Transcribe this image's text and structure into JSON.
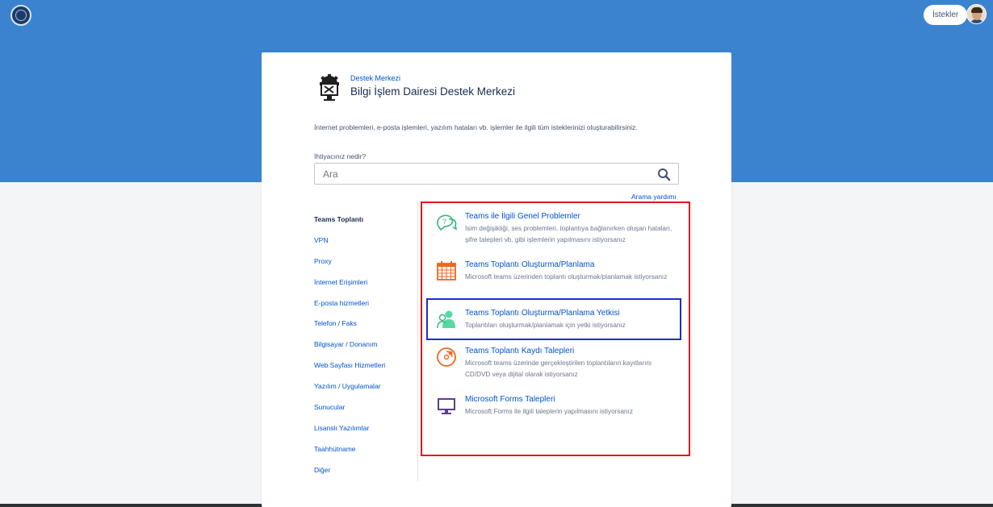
{
  "header": {
    "logo_icon": "university-logo-icon",
    "requests_label": "İstekler",
    "avatar_icon": "user-avatar-icon",
    "accent_color": "#3b83cf"
  },
  "help_center": {
    "icon": "gear-monitor-icon",
    "breadcrumb": "Destek Merkezi",
    "title": "Bilgi İşlem Dairesi Destek Merkezi",
    "intro": "İnternet problemleri, e-posta işlemleri, yazılım hataları vb. işlemler ile ilgili tüm isteklerinizi oluşturabilirsiniz."
  },
  "search": {
    "label": "İhtiyacınız nedir?",
    "placeholder": "Ara",
    "help_link": "Arama yardımı"
  },
  "sidebar": {
    "items": [
      {
        "label": "Teams Toplantı",
        "active": true
      },
      {
        "label": "VPN"
      },
      {
        "label": "Proxy"
      },
      {
        "label": "İnternet Erişimleri"
      },
      {
        "label": "E-posta hizmetleri"
      },
      {
        "label": "Telefon / Faks"
      },
      {
        "label": "Bilgisayar / Donanım"
      },
      {
        "label": "Web Sayfası Hizmetleri"
      },
      {
        "label": "Yazılım / Uygulamalar"
      },
      {
        "label": "Sunucular"
      },
      {
        "label": "Lisanslı Yazılımlar"
      },
      {
        "label": "Taahhütname"
      },
      {
        "label": "Diğer"
      }
    ]
  },
  "request_types": [
    {
      "icon": "question-bubble-icon",
      "name": "Teams ile İlgili Genel Problemler",
      "description": "İsim değişikliği, ses problemleri, toplantıya bağlanırken oluşan hataları, şifre talepleri vb. gibi işlemlerin yapılmasını istiyorsanız"
    },
    {
      "icon": "calendar-icon",
      "name": "Teams Toplantı Oluşturma/Planlama",
      "description": "Microsoft teams üzerinden toplantı oluşturmak/planlamak istiyorsanız"
    },
    {
      "icon": "user-permission-icon",
      "name": "Teams Toplantı Oluşturma/Planlama Yetkisi",
      "description": "Toplantıları oluşturmak/planlamak için yetki istiyorsanız"
    },
    {
      "icon": "disc-record-icon",
      "name": "Teams Toplantı Kaydı Talepleri",
      "description": "Microsoft teams üzerinde gerçekleştirilen toplantıların kayıtlarını CD/DVD veya dijital olarak istiyorsanız"
    },
    {
      "icon": "monitor-icon",
      "name": "Microsoft Forms Talepleri",
      "description": "Microsoft Forms ile ilgili taleplerin yapılmasını istiyorsanız"
    }
  ]
}
